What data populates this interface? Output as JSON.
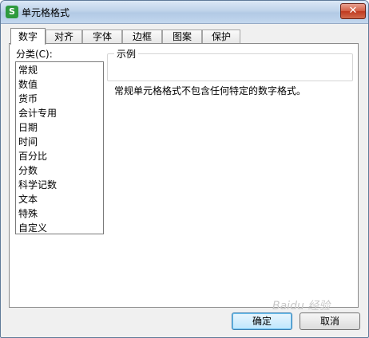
{
  "window": {
    "title": "单元格格式",
    "close_glyph": "✕"
  },
  "tabs": [
    "数字",
    "对齐",
    "字体",
    "边框",
    "图案",
    "保护"
  ],
  "number_tab": {
    "category_label": "分类(C):",
    "categories": [
      "常规",
      "数值",
      "货币",
      "会计专用",
      "日期",
      "时间",
      "百分比",
      "分数",
      "科学记数",
      "文本",
      "特殊",
      "自定义"
    ],
    "sample_label": "示例",
    "description": "常规单元格格式不包含任何特定的数字格式。"
  },
  "buttons": {
    "ok": "确定",
    "cancel": "取消"
  },
  "watermark": "Baidu 经验"
}
